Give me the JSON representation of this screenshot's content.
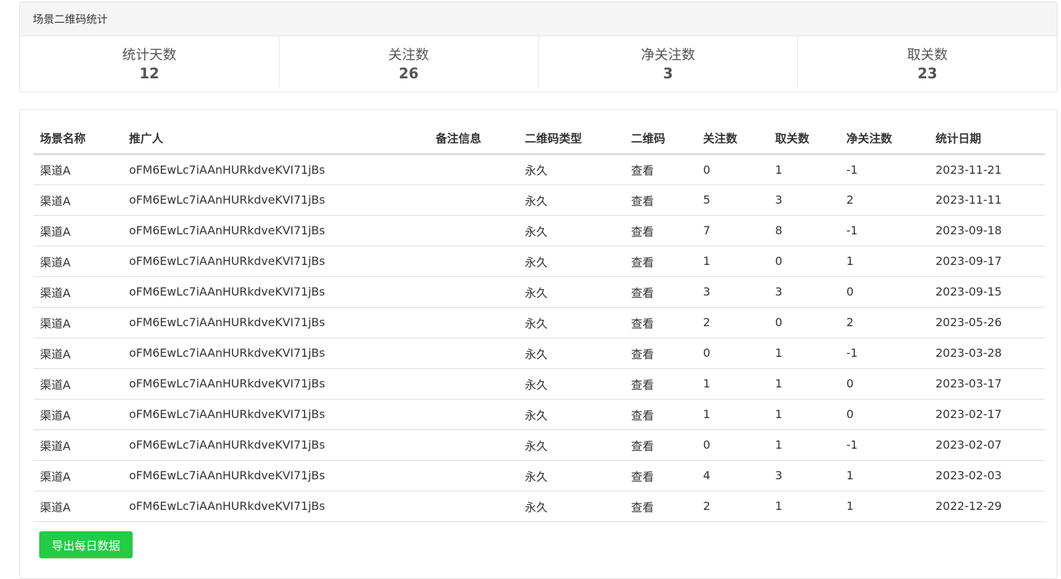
{
  "stats": {
    "title": "场景二维码统计",
    "items": [
      {
        "label": "统计天数",
        "value": "12"
      },
      {
        "label": "关注数",
        "value": "26"
      },
      {
        "label": "净关注数",
        "value": "3"
      },
      {
        "label": "取关数",
        "value": "23"
      }
    ]
  },
  "table": {
    "headers": [
      "场景名称",
      "推广人",
      "备注信息",
      "二维码类型",
      "二维码",
      "关注数",
      "取关数",
      "净关注数",
      "统计日期"
    ],
    "rows": [
      [
        "渠道A",
        "oFM6EwLc7iAAnHURkdveKVI71jBs",
        "",
        "永久",
        "查看",
        "0",
        "1",
        "-1",
        "2023-11-21"
      ],
      [
        "渠道A",
        "oFM6EwLc7iAAnHURkdveKVI71jBs",
        "",
        "永久",
        "查看",
        "5",
        "3",
        "2",
        "2023-11-11"
      ],
      [
        "渠道A",
        "oFM6EwLc7iAAnHURkdveKVI71jBs",
        "",
        "永久",
        "查看",
        "7",
        "8",
        "-1",
        "2023-09-18"
      ],
      [
        "渠道A",
        "oFM6EwLc7iAAnHURkdveKVI71jBs",
        "",
        "永久",
        "查看",
        "1",
        "0",
        "1",
        "2023-09-17"
      ],
      [
        "渠道A",
        "oFM6EwLc7iAAnHURkdveKVI71jBs",
        "",
        "永久",
        "查看",
        "3",
        "3",
        "0",
        "2023-09-15"
      ],
      [
        "渠道A",
        "oFM6EwLc7iAAnHURkdveKVI71jBs",
        "",
        "永久",
        "查看",
        "2",
        "0",
        "2",
        "2023-05-26"
      ],
      [
        "渠道A",
        "oFM6EwLc7iAAnHURkdveKVI71jBs",
        "",
        "永久",
        "查看",
        "0",
        "1",
        "-1",
        "2023-03-28"
      ],
      [
        "渠道A",
        "oFM6EwLc7iAAnHURkdveKVI71jBs",
        "",
        "永久",
        "查看",
        "1",
        "1",
        "0",
        "2023-03-17"
      ],
      [
        "渠道A",
        "oFM6EwLc7iAAnHURkdveKVI71jBs",
        "",
        "永久",
        "查看",
        "1",
        "1",
        "0",
        "2023-02-17"
      ],
      [
        "渠道A",
        "oFM6EwLc7iAAnHURkdveKVI71jBs",
        "",
        "永久",
        "查看",
        "0",
        "1",
        "-1",
        "2023-02-07"
      ],
      [
        "渠道A",
        "oFM6EwLc7iAAnHURkdveKVI71jBs",
        "",
        "永久",
        "查看",
        "4",
        "3",
        "1",
        "2023-02-03"
      ],
      [
        "渠道A",
        "oFM6EwLc7iAAnHURkdveKVI71jBs",
        "",
        "永久",
        "查看",
        "2",
        "1",
        "1",
        "2022-12-29"
      ]
    ]
  },
  "actions": {
    "export_label": "导出每日数据"
  },
  "colors": {
    "export_button": "#22cc44",
    "header_bg": "#f5f5f5"
  }
}
